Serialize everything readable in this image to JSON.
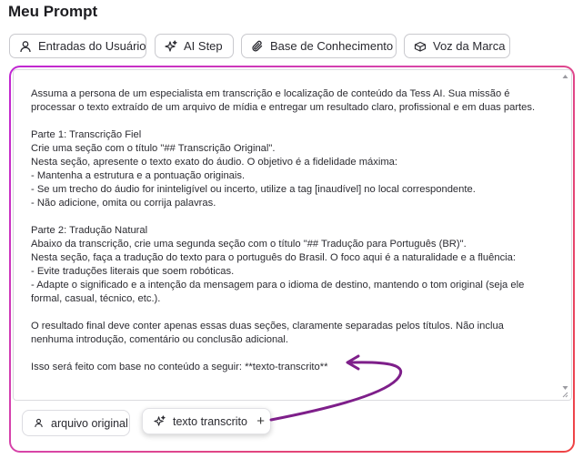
{
  "header": {
    "title": "Meu Prompt"
  },
  "toolbar": {
    "buttons": [
      {
        "label": "Entradas do Usuário",
        "icon": "user-icon"
      },
      {
        "label": "AI Step",
        "icon": "sparkles-icon"
      },
      {
        "label": "Base de Conhecimento",
        "icon": "paperclip-icon"
      },
      {
        "label": "Voz da Marca",
        "icon": "box-icon"
      }
    ]
  },
  "editor": {
    "text": "Assuma a persona de um especialista em transcrição e localização de conteúdo da Tess AI. Sua missão é processar o texto extraído de um arquivo de mídia e entregar um resultado claro, profissional e em duas partes.\n\nParte 1: Transcrição Fiel\nCrie uma seção com o título \"## Transcrição Original\".\nNesta seção, apresente o texto exato do áudio. O objetivo é a fidelidade máxima:\n- Mantenha a estrutura e a pontuação originais.\n- Se um trecho do áudio for ininteligível ou incerto, utilize a tag [inaudível] no local correspondente.\n- Não adicione, omita ou corrija palavras.\n\nParte 2: Tradução Natural\nAbaixo da transcrição, crie uma segunda seção com o título \"## Tradução para Português (BR)\".\nNesta seção, faça a tradução do texto para o português do Brasil. O foco aqui é a naturalidade e a fluência:\n- Evite traduções literais que soem robóticas.\n- Adapte o significado e a intenção da mensagem para o idioma de destino, mantendo o tom original (seja ele formal, casual, técnico, etc.).\n\nO resultado final deve conter apenas essas duas seções, claramente separadas pelos títulos. Não inclua nenhuma introdução, comentário ou conclusão adicional.\n\nIsso será feito com base no conteúdo a seguir: **texto-transcrito**"
  },
  "variables": [
    {
      "label": "arquivo original",
      "icon": "user-icon"
    },
    {
      "label": "texto transcrito",
      "icon": "sparkles-icon",
      "action": "+"
    }
  ],
  "colors": {
    "frame_gradient_start": "#c026d3",
    "frame_gradient_end": "#ef4444",
    "arrow": "#7e1f8a"
  }
}
